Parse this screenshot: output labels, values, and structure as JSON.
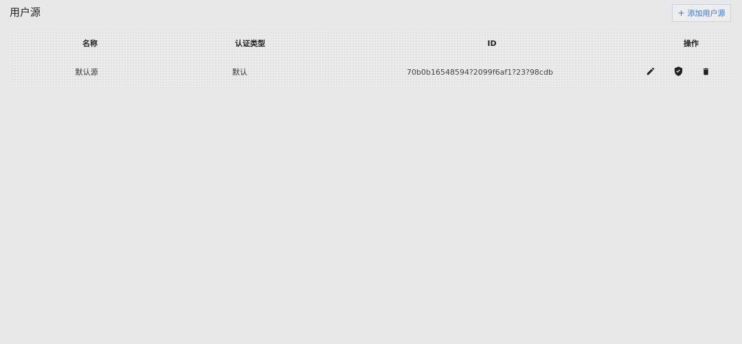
{
  "page": {
    "title": "用户源"
  },
  "toolbar": {
    "add_label": "添加用户源",
    "add_icon": "plus-icon"
  },
  "table": {
    "headers": {
      "name": "名称",
      "auth_type": "认证类型",
      "id": "ID",
      "actions": "操作"
    },
    "rows": [
      {
        "name": "默认源",
        "auth_type": "默认",
        "id": "70b0b16548594?2099f6af1?23?98cdb",
        "actions": [
          "edit-icon",
          "shield-check-icon",
          "delete-icon"
        ]
      }
    ]
  },
  "colors": {
    "background": "#e8e8e8",
    "accent": "#3b74c0",
    "icon": "#222222"
  }
}
